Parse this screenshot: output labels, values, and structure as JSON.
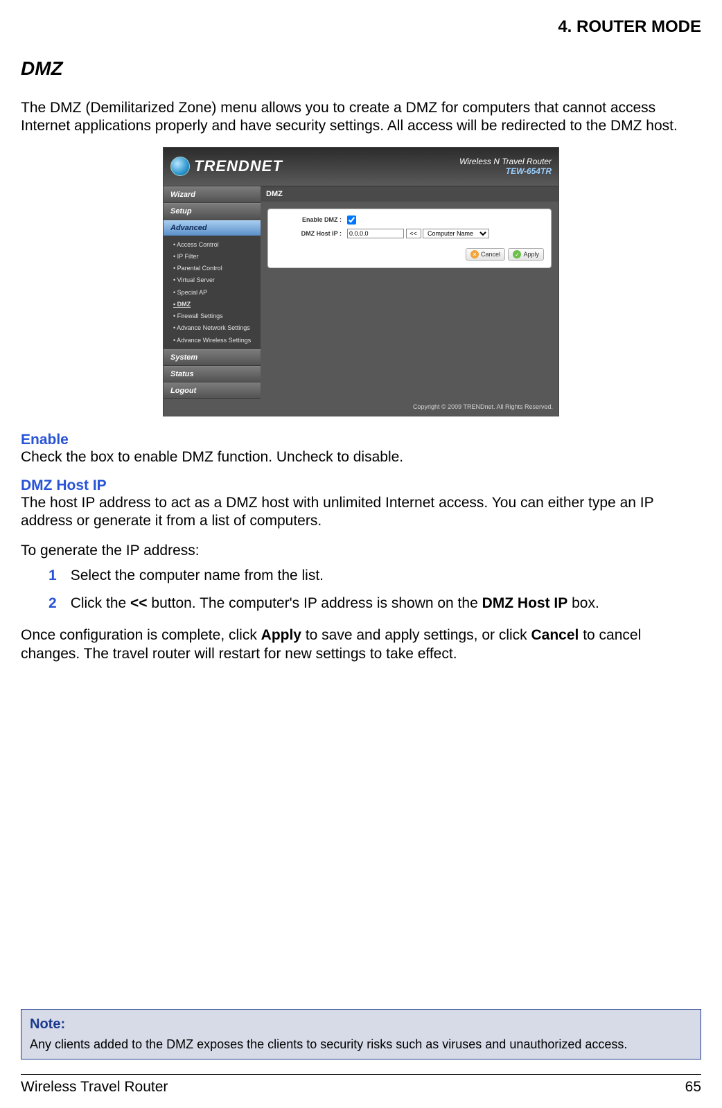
{
  "header": {
    "chapter": "4.  ROUTER MODE"
  },
  "section": {
    "title": "DMZ",
    "intro": "The DMZ (Demilitarized Zone) menu allows you to create a DMZ for computers that cannot access Internet applications properly and have security settings. All access will be redirected to the DMZ host."
  },
  "screenshot": {
    "brand": "TRENDNET",
    "product_line1": "Wireless N Travel Router",
    "product_model": "TEW-654TR",
    "nav": {
      "wizard": "Wizard",
      "setup": "Setup",
      "advanced": "Advanced",
      "system": "System",
      "status": "Status",
      "logout": "Logout"
    },
    "advanced_items": [
      "Access Control",
      "IP Filter",
      "Parental Control",
      "Virtual Server",
      "Special AP",
      "DMZ",
      "Firewall Settings",
      "Advance Network Settings",
      "Advance Wireless Settings"
    ],
    "panel": {
      "title": "DMZ",
      "enable_label": "Enable DMZ :",
      "hostip_label": "DMZ Host IP :",
      "hostip_value": "0.0.0.0",
      "lookup_btn": "<<",
      "computer_select": "Computer Name",
      "cancel": "Cancel",
      "apply": "Apply"
    },
    "copyright": "Copyright © 2009 TRENDnet. All Rights Reserved."
  },
  "fields": {
    "enable_heading": "Enable",
    "enable_desc": "Check the box to enable DMZ function. Uncheck to disable.",
    "hostip_heading": "DMZ Host IP",
    "hostip_desc": "The host IP address to act as a DMZ host with unlimited Internet access. You can either type an IP address or generate it from a list of computers.",
    "generate_intro": "To generate the IP address:",
    "step1": "Select the computer name from the list.",
    "step2_a": "Click the ",
    "step2_b": "<<",
    "step2_c": " button. The computer's IP address is shown on the ",
    "step2_d": "DMZ Host IP",
    "step2_e": " box."
  },
  "final": {
    "a": "Once configuration is complete, click ",
    "b": "Apply",
    "c": " to save and apply settings, or click ",
    "d": "Cancel",
    "e": " to cancel changes. The travel router will restart for new settings to take effect."
  },
  "note": {
    "label": "Note:",
    "text": "Any clients added to the DMZ exposes the clients to security risks such as viruses and unauthorized access."
  },
  "footer": {
    "left": "Wireless Travel Router",
    "right": "65"
  }
}
